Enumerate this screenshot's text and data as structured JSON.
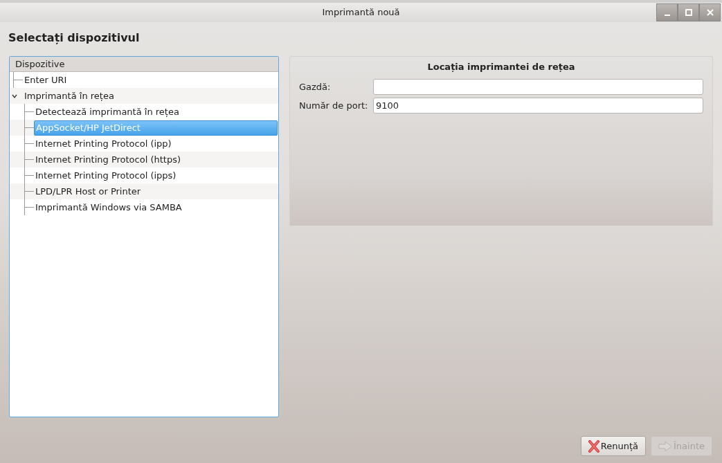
{
  "window": {
    "title": "Imprimantă nouă"
  },
  "heading": "Selectați dispozitivul",
  "tree": {
    "header": "Dispozitive",
    "items": [
      {
        "label": "Enter URI",
        "selected": false
      },
      {
        "label": "Imprimantă în rețea",
        "selected": false,
        "expanded": true,
        "children": [
          {
            "label": "Detectează imprimantă în rețea",
            "selected": false
          },
          {
            "label": "AppSocket/HP JetDirect",
            "selected": true
          },
          {
            "label": "Internet Printing Protocol (ipp)",
            "selected": false
          },
          {
            "label": "Internet Printing Protocol (https)",
            "selected": false
          },
          {
            "label": "Internet Printing Protocol (ipps)",
            "selected": false
          },
          {
            "label": "LPD/LPR Host or Printer",
            "selected": false
          },
          {
            "label": "Imprimantă Windows via SAMBA",
            "selected": false
          }
        ]
      }
    ]
  },
  "panel": {
    "title": "Locația imprimantei de rețea",
    "fields": [
      {
        "label": "Gazdă:"
      },
      {
        "label": "Număr de port:",
        "value": "9100"
      }
    ]
  },
  "buttons": [
    {
      "label": "Renunță",
      "kind": "cancel",
      "disabled": false
    },
    {
      "label": "Înainte",
      "kind": "forward",
      "disabled": true
    }
  ]
}
